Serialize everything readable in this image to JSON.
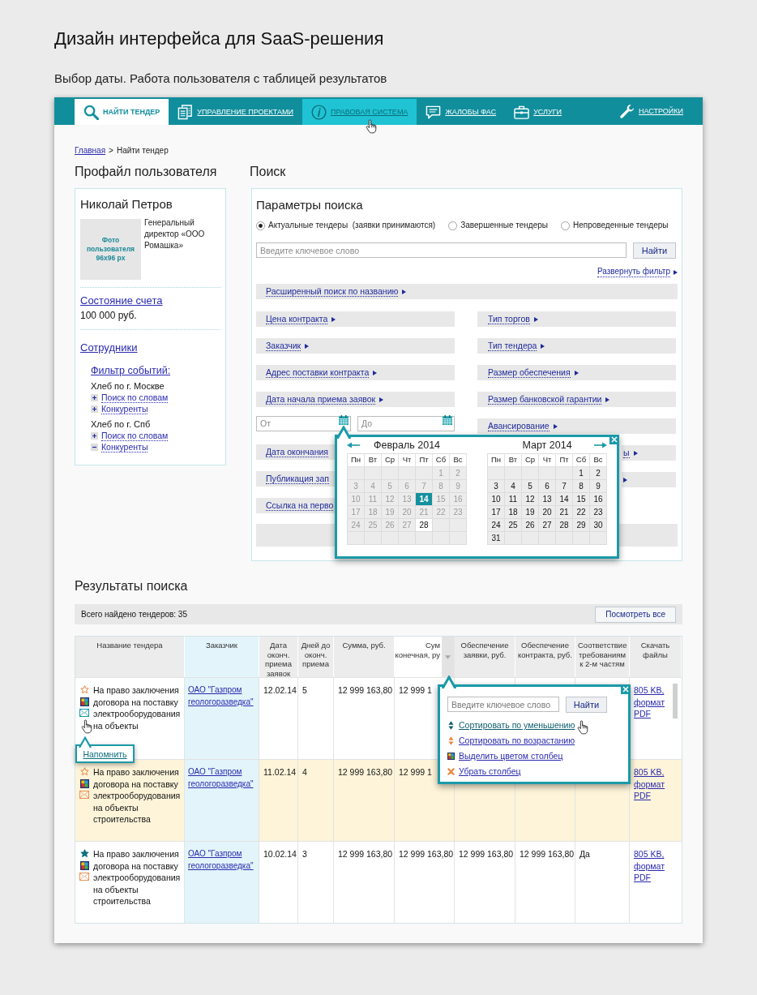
{
  "page": {
    "title": "Дизайн интерфейса для SaaS-решения",
    "subtitle": "Выбор даты. Работа пользователя с таблицей результатов"
  },
  "nav": {
    "tabs": [
      {
        "label": "НАЙТИ ТЕНДЕР",
        "selected": true,
        "hovered": false
      },
      {
        "label": "УПРАВЛЕНИЕ ПРОЕКТАМИ",
        "selected": false,
        "hovered": false
      },
      {
        "label": "ПРАВОВАЯ СИСТЕМА",
        "selected": false,
        "hovered": true
      },
      {
        "label": "ЖАЛОБЫ ФАС",
        "selected": false,
        "hovered": false
      },
      {
        "label": "УСЛУГИ",
        "selected": false,
        "hovered": false
      }
    ],
    "settings": {
      "label": "НАСТРОЙКИ"
    }
  },
  "breadcrumb": {
    "items": [
      {
        "label": "Главная",
        "link": true
      },
      {
        "label": "Найти тендер",
        "link": false
      }
    ],
    "separator": ">"
  },
  "profile": {
    "heading": "Профайл пользователя",
    "name": "Николай Петров",
    "photo_caption": "Фото пользователя 96x96 px",
    "position": "Генеральный директор «ООО Ромашка»",
    "account_link": "Состояние счета",
    "balance": "100 000 руб.",
    "staff_link": "Сотрудники",
    "event_filter": {
      "title": "Фильтр событий:",
      "groups": [
        {
          "name": "Хлеб по г. Москве",
          "items": [
            {
              "label": "Поиск по словам",
              "expanded": false
            },
            {
              "label": "Конкуренты",
              "expanded": false
            }
          ]
        },
        {
          "name": "Хлеб по г. Спб",
          "items": [
            {
              "label": "Поиск по словам",
              "expanded": false
            },
            {
              "label": "Конкуренты",
              "expanded": true
            }
          ]
        }
      ]
    }
  },
  "search": {
    "heading": "Поиск",
    "title": "Параметры поиска",
    "status_options": [
      {
        "label": "Актуальные тендеры  (заявки принимаются)",
        "selected": true
      },
      {
        "label": "Завершенные тендеры",
        "selected": false
      },
      {
        "label": "Непроведенные тендеры",
        "selected": false
      }
    ],
    "keyword": {
      "placeholder": "Введите ключевое слово",
      "button": "Найти"
    },
    "expand_link": "Развернуть фильтр",
    "name_filter": {
      "label": "Расширенный поиск по названию"
    },
    "filters_left": [
      {
        "label": "Цена контракта",
        "covered": false
      },
      {
        "label": "Заказчик",
        "covered": false
      },
      {
        "label": "Адрес поставки контракта",
        "covered": false
      },
      {
        "label": "Дата начала приема заявок",
        "covered": false,
        "date_range": {
          "from_placeholder": "От",
          "to_placeholder": "До"
        }
      },
      {
        "label": "Дата окончания",
        "covered": true
      },
      {
        "label": "Публикация зап",
        "covered": true
      },
      {
        "label": "Ссылка на перво",
        "covered": true
      }
    ],
    "filters_right": [
      {
        "label": "Тип торгов",
        "covered": false
      },
      {
        "label": "Тип тендера",
        "covered": false
      },
      {
        "label": "Размер обеспечения",
        "covered": false
      },
      {
        "label": "Размер банковской гарантии",
        "covered": false
      },
      {
        "label": "Авансирование",
        "covered": false
      },
      {
        "label": "ы",
        "covered": true
      },
      {
        "covered": true
      }
    ]
  },
  "date_picker": {
    "months": [
      {
        "title": "Февраль 2014",
        "weekdays": [
          "Пн",
          "Вт",
          "Ср",
          "Чт",
          "Пт",
          "Сб",
          "Вс"
        ],
        "weeks": [
          {
            "align_end": true,
            "days": [
              {
                "day": "1",
                "selected": false,
                "muted": true,
                "highlighted": false
              },
              {
                "day": "2",
                "selected": false,
                "muted": true,
                "highlighted": false
              }
            ]
          },
          {
            "days": [
              {
                "day": "3",
                "selected": false,
                "muted": true,
                "highlighted": false
              },
              {
                "day": "4",
                "selected": false,
                "muted": true,
                "highlighted": false
              },
              {
                "day": "5",
                "selected": false,
                "muted": true,
                "highlighted": false
              },
              {
                "day": "6",
                "selected": false,
                "muted": true,
                "highlighted": false
              },
              {
                "day": "7",
                "selected": false,
                "muted": true,
                "highlighted": false
              },
              {
                "day": "8",
                "selected": false,
                "muted": true,
                "highlighted": false
              },
              {
                "day": "9",
                "selected": false,
                "muted": true,
                "highlighted": false
              }
            ]
          },
          {
            "days": [
              {
                "day": "10",
                "selected": false,
                "muted": true,
                "highlighted": false
              },
              {
                "day": "11",
                "selected": false,
                "muted": true,
                "highlighted": false
              },
              {
                "day": "12",
                "selected": false,
                "muted": true,
                "highlighted": false
              },
              {
                "day": "13",
                "selected": false,
                "muted": true,
                "highlighted": false
              },
              {
                "day": "14",
                "selected": true,
                "muted": false,
                "highlighted": false
              },
              {
                "day": "15",
                "selected": false,
                "muted": true,
                "highlighted": false
              },
              {
                "day": "16",
                "selected": false,
                "muted": true,
                "highlighted": false
              }
            ]
          },
          {
            "days": [
              {
                "day": "17",
                "selected": false,
                "muted": true,
                "highlighted": false
              },
              {
                "day": "18",
                "selected": false,
                "muted": true,
                "highlighted": false
              },
              {
                "day": "19",
                "selected": false,
                "muted": true,
                "highlighted": false
              },
              {
                "day": "20",
                "selected": false,
                "muted": true,
                "highlighted": false
              },
              {
                "day": "21",
                "selected": false,
                "muted": true,
                "highlighted": false
              },
              {
                "day": "22",
                "selected": false,
                "muted": true,
                "highlighted": false
              },
              {
                "day": "23",
                "selected": false,
                "muted": true,
                "highlighted": false
              }
            ]
          },
          {
            "align_end": false,
            "days": [
              {
                "day": "24",
                "selected": false,
                "muted": true,
                "highlighted": false
              },
              {
                "day": "25",
                "selected": false,
                "muted": true,
                "highlighted": false
              },
              {
                "day": "26",
                "selected": false,
                "muted": true,
                "highlighted": false
              },
              {
                "day": "27",
                "selected": false,
                "muted": true,
                "highlighted": false
              },
              {
                "day": "28",
                "selected": false,
                "muted": false,
                "highlighted": true
              }
            ]
          }
        ]
      },
      {
        "title": "Март 2014",
        "weekdays": [
          "Пн",
          "Вт",
          "Ср",
          "Чт",
          "Пт",
          "Сб",
          "Вс"
        ],
        "weeks": [
          {
            "align_end": true,
            "days": [
              {
                "day": "1",
                "selected": false,
                "muted": false,
                "highlighted": false
              },
              {
                "day": "2",
                "selected": false,
                "muted": false,
                "highlighted": false
              }
            ]
          },
          {
            "days": [
              {
                "day": "3",
                "selected": false,
                "muted": false,
                "highlighted": false
              },
              {
                "day": "4",
                "selected": false,
                "muted": false,
                "highlighted": false
              },
              {
                "day": "5",
                "selected": false,
                "muted": false,
                "highlighted": false
              },
              {
                "day": "6",
                "selected": false,
                "muted": false,
                "highlighted": false
              },
              {
                "day": "7",
                "selected": false,
                "muted": false,
                "highlighted": false
              },
              {
                "day": "8",
                "selected": false,
                "muted": false,
                "highlighted": false
              },
              {
                "day": "9",
                "selected": false,
                "muted": false,
                "highlighted": false
              }
            ]
          },
          {
            "days": [
              {
                "day": "10",
                "selected": false,
                "muted": false,
                "highlighted": false
              },
              {
                "day": "11",
                "selected": false,
                "muted": false,
                "highlighted": false
              },
              {
                "day": "12",
                "selected": false,
                "muted": false,
                "highlighted": false
              },
              {
                "day": "13",
                "selected": false,
                "muted": false,
                "highlighted": false
              },
              {
                "day": "14",
                "selected": false,
                "muted": false,
                "highlighted": false
              },
              {
                "day": "15",
                "selected": false,
                "muted": false,
                "highlighted": false
              },
              {
                "day": "16",
                "selected": false,
                "muted": false,
                "highlighted": false
              }
            ]
          },
          {
            "days": [
              {
                "day": "17",
                "selected": false,
                "muted": false,
                "highlighted": false
              },
              {
                "day": "18",
                "selected": false,
                "muted": false,
                "highlighted": false
              },
              {
                "day": "19",
                "selected": false,
                "muted": false,
                "highlighted": false
              },
              {
                "day": "20",
                "selected": false,
                "muted": false,
                "highlighted": false
              },
              {
                "day": "21",
                "selected": false,
                "muted": false,
                "highlighted": false
              },
              {
                "day": "22",
                "selected": false,
                "muted": false,
                "highlighted": false
              },
              {
                "day": "23",
                "selected": false,
                "muted": false,
                "highlighted": false
              }
            ]
          },
          {
            "days": [
              {
                "day": "24",
                "selected": false,
                "muted": false,
                "highlighted": false
              },
              {
                "day": "25",
                "selected": false,
                "muted": false,
                "highlighted": false
              },
              {
                "day": "26",
                "selected": false,
                "muted": false,
                "highlighted": false
              },
              {
                "day": "27",
                "selected": false,
                "muted": false,
                "highlighted": false
              },
              {
                "day": "28",
                "selected": false,
                "muted": false,
                "highlighted": false
              },
              {
                "day": "29",
                "selected": false,
                "muted": false,
                "highlighted": false
              },
              {
                "day": "30",
                "selected": false,
                "muted": false,
                "highlighted": false
              }
            ]
          },
          {
            "align_end": false,
            "days": [
              {
                "day": "31",
                "selected": false,
                "muted": false,
                "highlighted": false
              }
            ]
          }
        ]
      }
    ]
  },
  "results": {
    "heading": "Результаты поиска",
    "total": "Всего найдено тендеров: 35",
    "view_all": "Посмотреть все",
    "columns": [
      {
        "label": "Название тендера",
        "highlighted": false,
        "menu_open": false
      },
      {
        "label": "Заказчик",
        "highlighted": true,
        "menu_open": false
      },
      {
        "label": "Дата оконч. приема заявок",
        "highlighted": false,
        "menu_open": false
      },
      {
        "label": "Дней до оконч. приема",
        "highlighted": false,
        "menu_open": false
      },
      {
        "label": "Сумма, руб.",
        "highlighted": false,
        "menu_open": false
      },
      {
        "label": "Сум\nконечная, ру",
        "highlighted": false,
        "menu_open": true
      },
      {
        "label": "Обеспечение заявки, руб.",
        "highlighted": false,
        "menu_open": false
      },
      {
        "label": "Обеспечение контракта, руб.",
        "highlighted": false,
        "menu_open": false
      },
      {
        "label": "Соответствие требованиям к 2-м частям",
        "highlighted": false,
        "menu_open": false
      },
      {
        "label": "Скачать файлы",
        "highlighted": false,
        "menu_open": false
      }
    ],
    "column_menu": {
      "placeholder": "Введите ключевое слово",
      "button": "Найти",
      "items": [
        {
          "kind": "sort_desc",
          "label": "Сортировать по уменьшению",
          "hovered": true
        },
        {
          "kind": "sort_asc",
          "label": "Сортировать по возрастанию",
          "hovered": false
        },
        {
          "kind": "highlight",
          "label": "Выделить цветом столбец",
          "hovered": false
        },
        {
          "kind": "remove",
          "label": "Убрать столбец",
          "hovered": false
        }
      ]
    },
    "rows": [
      {
        "selected": false,
        "starred": false,
        "reminder_hovered": true,
        "reminder_tooltip": "Напомнить",
        "title": "На право заключения договора на поставку электрооборудования на объекты",
        "customer": "ОАО \"Газпром геологоразведка\"",
        "end_date": "12.02.14",
        "days_left": "5",
        "sum": "12 999 163,80",
        "final_sum": "12 999 1",
        "files": "805 KB, формат PDF"
      },
      {
        "selected": true,
        "starred": false,
        "reminder_hovered": false,
        "title": "На право заключения договора на поставку электрооборудования на объекты строительства",
        "customer": "ОАО \"Газпром геологоразведка\"",
        "end_date": "11.02.14",
        "days_left": "4",
        "sum": "12 999 163,80",
        "final_sum": "12 999 1",
        "files": "805 KB, формат PDF"
      },
      {
        "selected": false,
        "starred": true,
        "reminder_hovered": false,
        "title": "На право заключения договора на поставку электрооборудования на объекты строительства",
        "customer": "ОАО \"Газпром геологоразведка\"",
        "end_date": "10.02.14",
        "days_left": "3",
        "sum": "12 999 163,80",
        "final_sum": "12 999 163,80",
        "bid_security": "12 999 163,80",
        "contract_security": "12 999 163,80",
        "compliance": "Да",
        "files": "805 KB, формат PDF"
      }
    ]
  }
}
